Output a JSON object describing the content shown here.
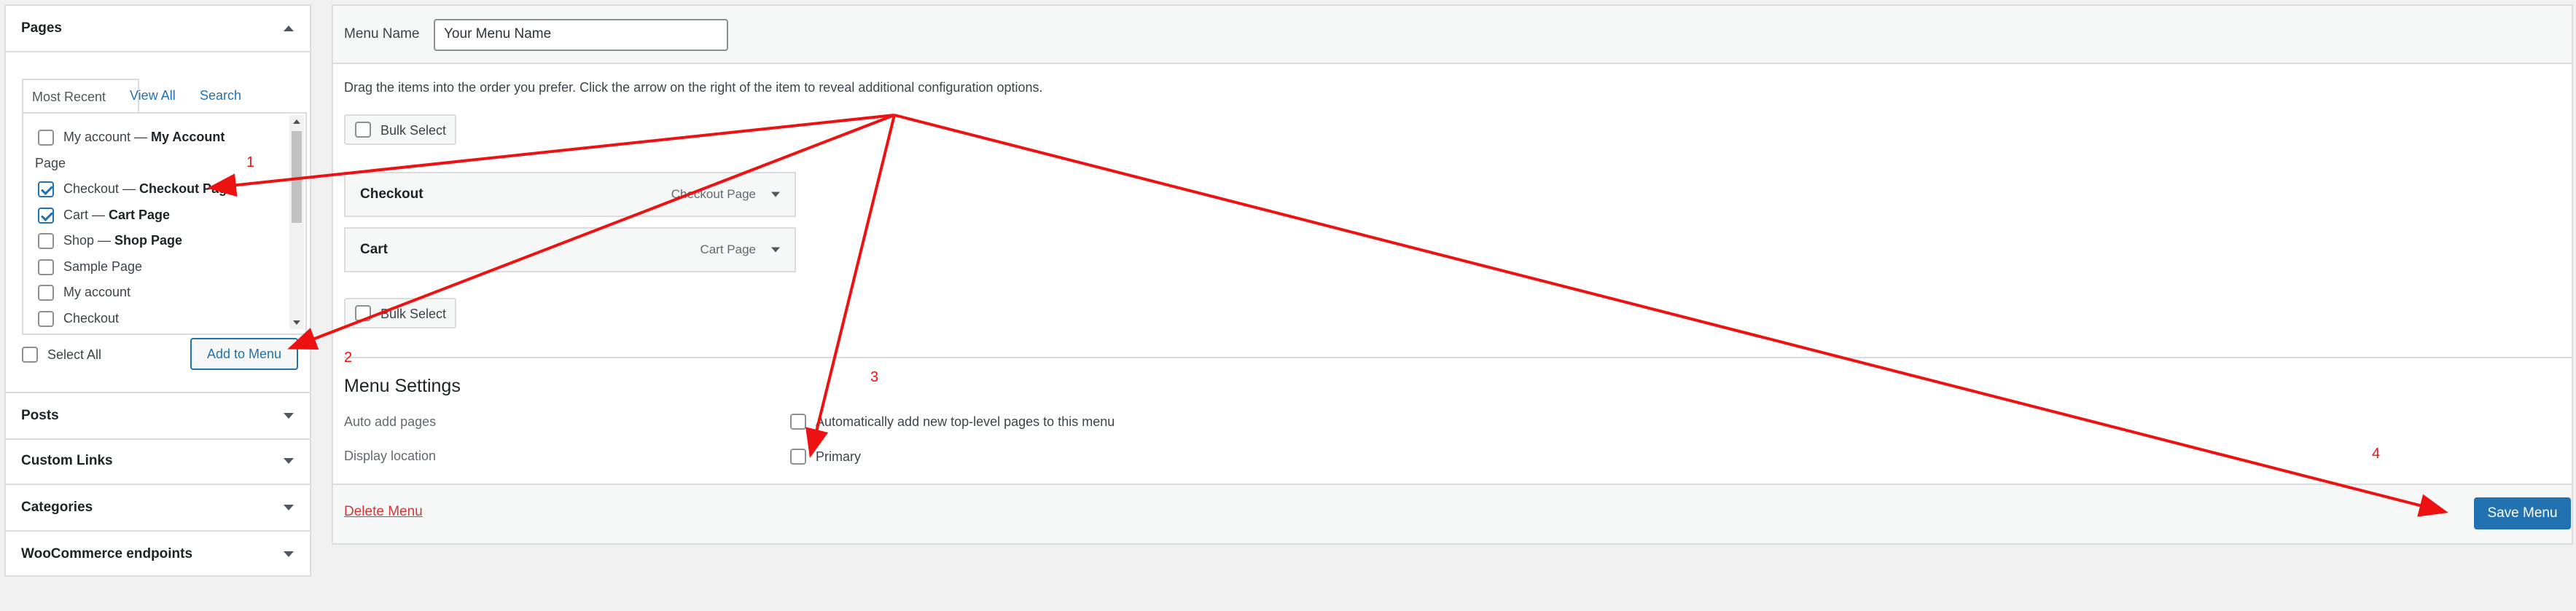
{
  "left": {
    "pages": {
      "title": "Pages",
      "tabs": [
        "Most Recent",
        "View All",
        "Search"
      ],
      "items": [
        {
          "label": "My account — ",
          "bold": "My Account",
          "wrap": "Page",
          "checked": false
        },
        {
          "label": "Checkout — ",
          "bold": "Checkout Page",
          "checked": true
        },
        {
          "label": "Cart — ",
          "bold": "Cart Page",
          "checked": true
        },
        {
          "label": "Shop — ",
          "bold": "Shop Page",
          "checked": false
        },
        {
          "label": "Sample Page",
          "bold": "",
          "checked": false
        },
        {
          "label": "My account",
          "bold": "",
          "checked": false
        },
        {
          "label": "Checkout",
          "bold": "",
          "checked": false
        }
      ],
      "select_all": "Select All",
      "add_to_menu": "Add to Menu"
    },
    "sections": [
      "Posts",
      "Custom Links",
      "Categories",
      "WooCommerce endpoints"
    ]
  },
  "menu": {
    "name_label": "Menu Name",
    "name_value": "Your Menu Name",
    "instructions": "Drag the items into the order you prefer. Click the arrow on the right of the item to reveal additional configuration options.",
    "bulk_select": "Bulk Select",
    "items": [
      {
        "title": "Checkout",
        "type": "Checkout Page"
      },
      {
        "title": "Cart",
        "type": "Cart Page"
      }
    ],
    "settings": {
      "heading": "Menu Settings",
      "auto_add_label": "Auto add pages",
      "auto_add_text": "Automatically add new top-level pages to this menu",
      "display_label": "Display location",
      "primary": "Primary"
    },
    "delete": "Delete Menu",
    "save": "Save Menu"
  },
  "annotations": [
    "1",
    "2",
    "3",
    "4"
  ],
  "colors": {
    "accent": "#2271b1",
    "annotation": "#e11",
    "danger": "#d63638"
  }
}
